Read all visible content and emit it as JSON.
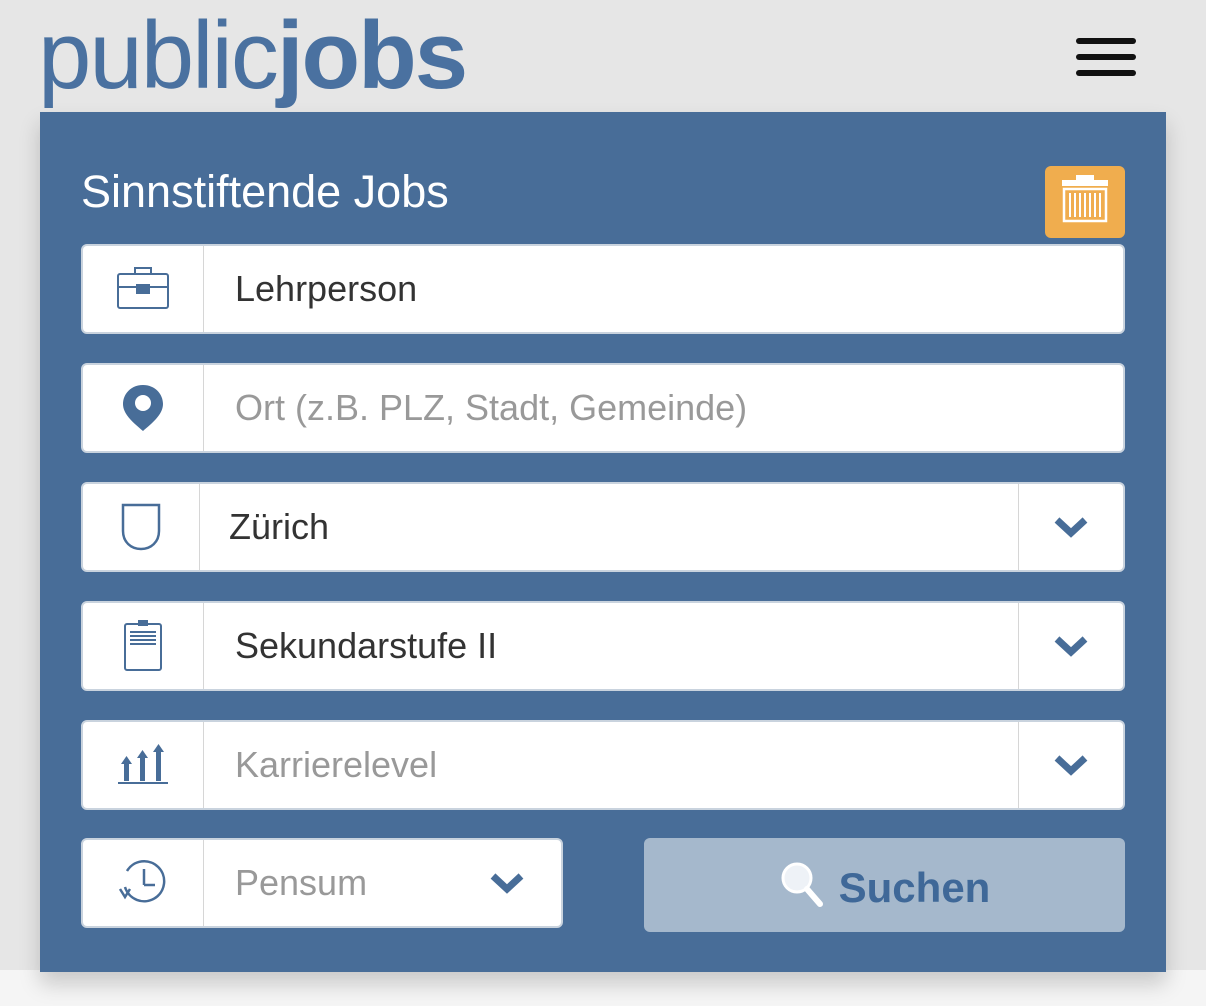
{
  "logo": {
    "light": "public",
    "bold": "jobs"
  },
  "header": {
    "menu_icon": "hamburger-menu-icon"
  },
  "search_panel": {
    "title": "Sinnstiftende Jobs",
    "clear_icon": "trash-icon",
    "fields": {
      "job": {
        "icon": "briefcase-icon",
        "value": "Lehrperson"
      },
      "location": {
        "icon": "location-pin-icon",
        "placeholder": "Ort (z.B. PLZ, Stadt, Gemeinde)"
      },
      "canton": {
        "icon": "shield-icon",
        "value": "Zürich"
      },
      "level": {
        "icon": "clipboard-icon",
        "value": "Sekundarstufe II"
      },
      "career": {
        "icon": "growth-arrows-icon",
        "placeholder": "Karrierelevel"
      },
      "pensum": {
        "icon": "clock-icon",
        "placeholder": "Pensum"
      }
    },
    "search_button": {
      "label": "Suchen",
      "icon": "search-icon"
    }
  },
  "colors": {
    "brand": "#4a71a0",
    "panel": "#486d98",
    "accent_orange": "#f0ad4e",
    "search_button": "#a5b8cc"
  }
}
